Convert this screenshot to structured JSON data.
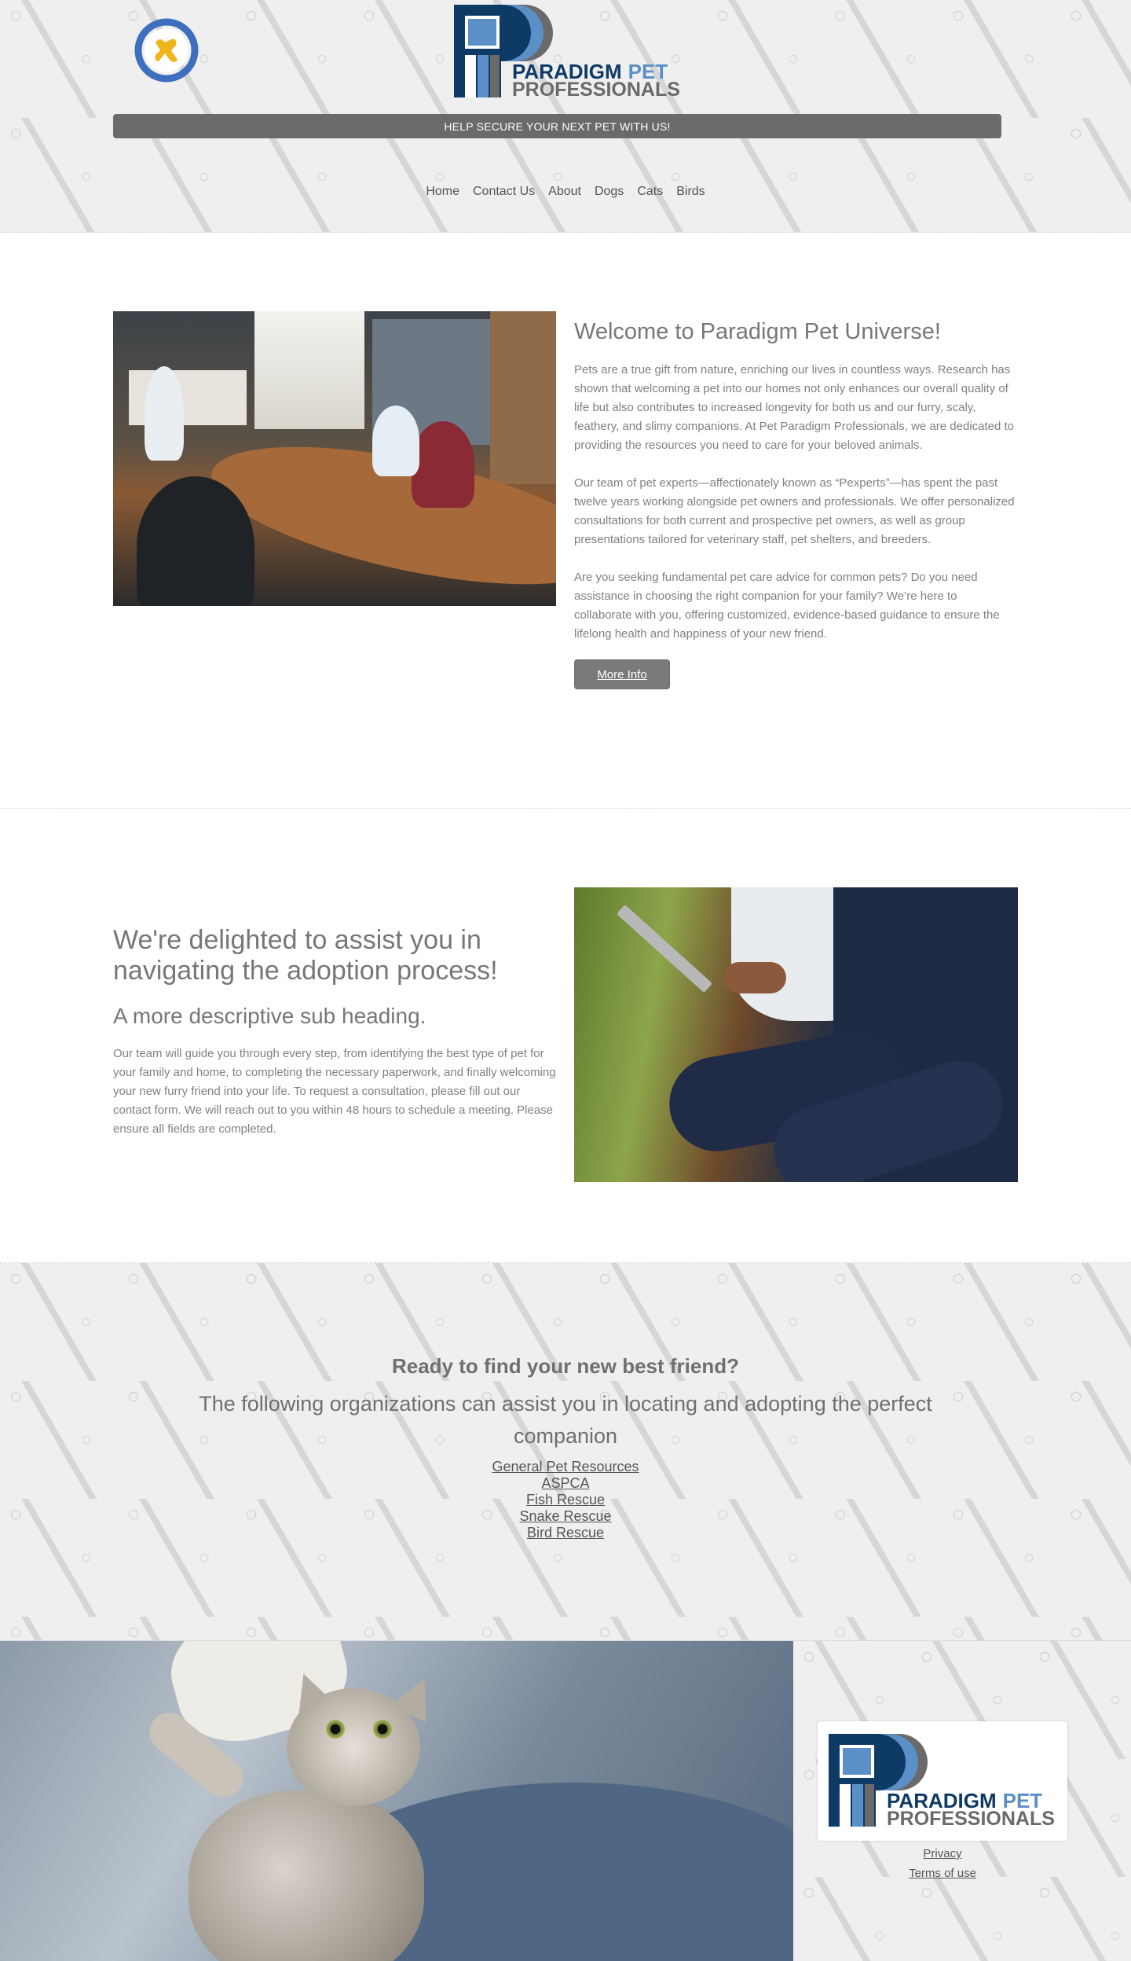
{
  "header": {
    "logo_name": "PARADIGM",
    "logo_name_accent": "PET",
    "logo_sub": "PROFESSIONALS",
    "banner": "HELP SECURE YOUR NEXT PET WITH US!",
    "nav": [
      "Home",
      "Contact Us",
      "About",
      "Dogs",
      "Cats",
      "Birds"
    ],
    "brand_colors": {
      "navy": "#0e3a66",
      "blue": "#5b8fc7",
      "gray": "#6a6a6a",
      "gold": "#f1b51c"
    }
  },
  "section1": {
    "title": "Welcome to Paradigm Pet Universe!",
    "paragraphs": [
      "Pets are a true gift from nature, enriching our lives in countless ways. Research has shown that welcoming a pet into our homes not only enhances our overall quality of life but also contributes to increased longevity for both us and our furry, scaly, feathery, and slimy companions. At Pet Paradigm Professionals, we are dedicated to providing the resources you need to care for your beloved animals.",
      "Our team of pet experts—affectionately known as “Pexperts”—has spent the past twelve years working alongside pet owners and professionals. We offer personalized consultations for both current and prospective pet owners, as well as group presentations tailored for veterinary staff, pet shelters, and breeders.",
      "Are you seeking fundamental pet care advice for common pets? Do you need assistance in choosing the right companion for your family? We’re here to collaborate with you, offering customized, evidence-based guidance to ensure the lifelong health and happiness of your new friend."
    ],
    "button": "More Info"
  },
  "section2": {
    "title": "We're delighted to assist you in navigating the adoption process!",
    "subtitle": "A more descriptive sub heading.",
    "paragraph": "Our team will guide you through every step, from identifying the best type of pet for your family and home, to completing the necessary paperwork, and finally welcoming your new furry friend into your life. To request a consultation, please fill out our contact form. We will reach out to you within 48 hours to schedule a meeting. Please ensure all fields are completed."
  },
  "section3": {
    "title": "Ready to find your new best friend?",
    "subtitle": "The following organizations can assist you in locating and adopting the perfect companion",
    "links": [
      "General Pet Resources",
      "ASPCA",
      "Fish Rescue",
      "Snake Rescue",
      "Bird Rescue"
    ]
  },
  "footer": {
    "links": [
      "Privacy",
      "Terms of use"
    ]
  }
}
